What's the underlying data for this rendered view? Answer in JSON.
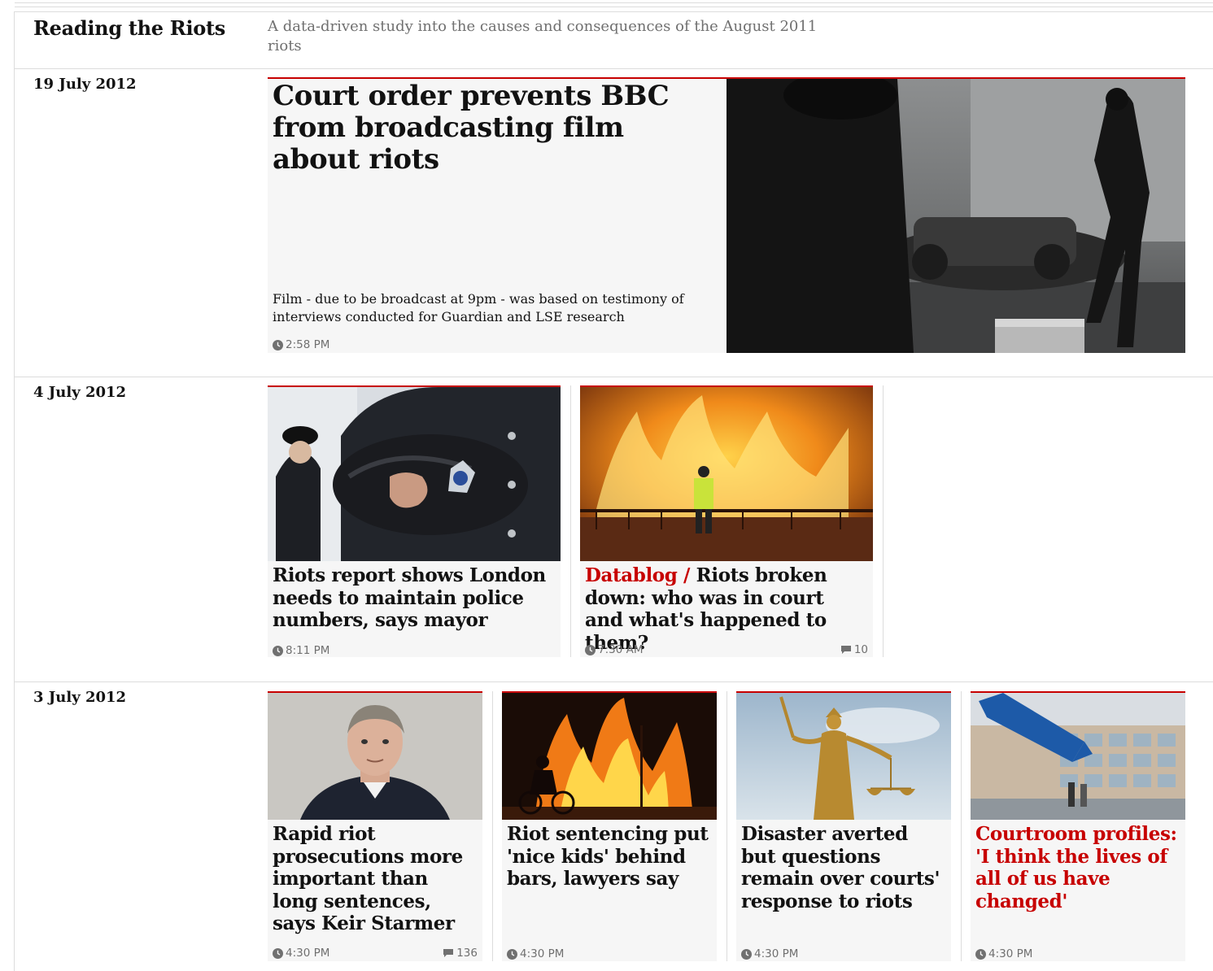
{
  "series": {
    "title": "Reading the Riots",
    "description": "A data-driven study into the causes and consequences of the August 2011 riots"
  },
  "groups": [
    {
      "date": "19 July 2012",
      "cards": [
        {
          "headline": "Court order prevents BBC from broadcasting film about riots",
          "standfirst": "Film - due to be broadcast at 9pm - was based on testimony of interviews conducted for Guardian and LSE research",
          "time": "2:58 PM",
          "image": "riot-police-burnt-car-photo"
        }
      ]
    },
    {
      "date": "4 July 2012",
      "cards": [
        {
          "headline": "Riots report shows London needs to maintain police numbers, says mayor",
          "time": "8:11 PM",
          "image": "police-officer-hat-photo"
        },
        {
          "kicker": "Datablog / ",
          "headline": "Riots broken down: who was in court and what's happened to them?",
          "time": "7:30 AM",
          "comments": "10",
          "image": "burning-building-firefighter-photo"
        }
      ]
    },
    {
      "date": "3 July 2012",
      "cards": [
        {
          "headline": "Rapid riot prosecutions more important than long sentences, says Keir Starmer",
          "time": "4:30 PM",
          "comments": "136",
          "image": "keir-starmer-portrait-photo"
        },
        {
          "headline": "Riot sentencing put 'nice kids' behind bars, lawyers say",
          "time": "4:30 PM",
          "image": "fire-cyclist-photo"
        },
        {
          "headline": "Disaster averted but questions remain over courts' response to riots",
          "time": "4:30 PM",
          "image": "lady-justice-statue-photo"
        },
        {
          "headline": "Courtroom profiles: 'I think the lives of all of us have changed'",
          "time": "4:30 PM",
          "image": "magistrates-court-sign-photo"
        }
      ]
    }
  ],
  "colors": {
    "accent": "#c70000",
    "card_bg": "#f6f6f6",
    "meta": "#707070"
  }
}
